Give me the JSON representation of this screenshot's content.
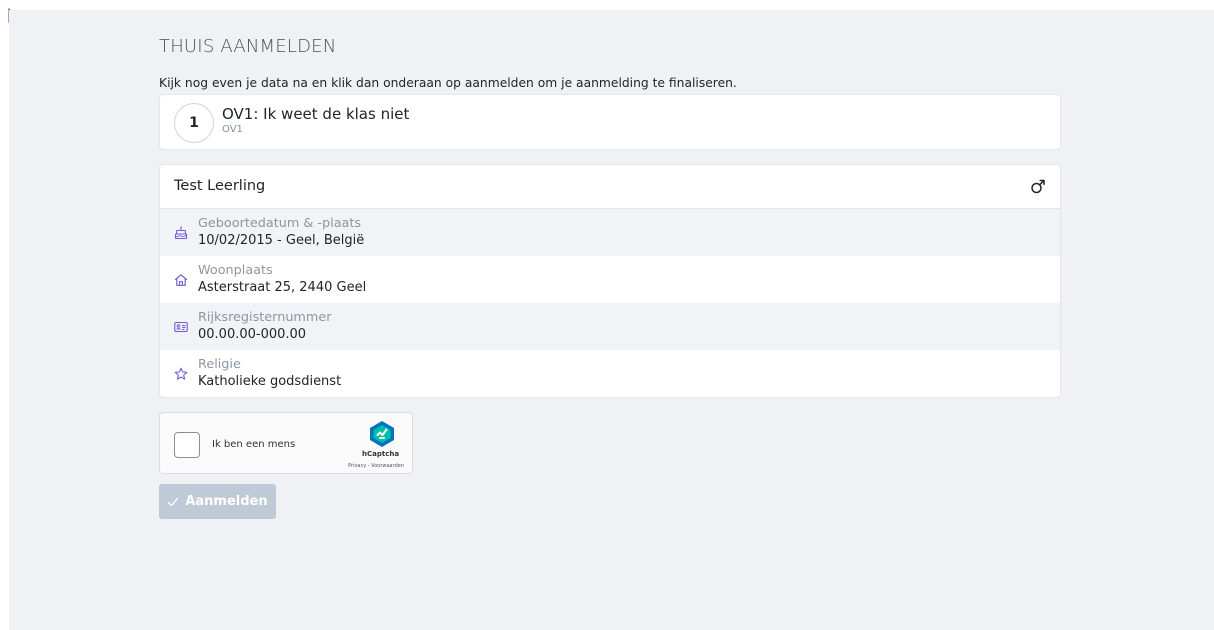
{
  "page": {
    "title": "THUIS AANMELDEN",
    "intro": "Kijk nog even je data na en klik dan onderaan op aanmelden om je aanmelding te finaliseren."
  },
  "class_choice": {
    "step": "1",
    "name": "OV1: Ik weet de klas niet",
    "code": "OV1"
  },
  "student": {
    "name": "Test Leerling",
    "gender_icon": "male-symbol-icon",
    "details": [
      {
        "icon": "cake-icon",
        "label": "Geboortedatum & -plaats",
        "value": "10/02/2015 - Geel, België"
      },
      {
        "icon": "home-icon",
        "label": "Woonplaats",
        "value": "Asterstraat 25, 2440 Geel"
      },
      {
        "icon": "id-card-icon",
        "label": "Rijksregisternummer",
        "value": "00.00.00-000.00"
      },
      {
        "icon": "star-icon",
        "label": "Religie",
        "value": "Katholieke godsdienst"
      }
    ]
  },
  "captcha": {
    "label": "Ik ben een mens",
    "brand": "hCaptcha",
    "links": "Privacy - Voorwaarden"
  },
  "submit": {
    "icon": "check-icon",
    "label": "Aanmelden"
  },
  "colors": {
    "page_background": "#eff1f5",
    "accent": "#6f5fd6",
    "button_disabled": "#c0c9d6",
    "captcha_brand": "#0074bf"
  }
}
